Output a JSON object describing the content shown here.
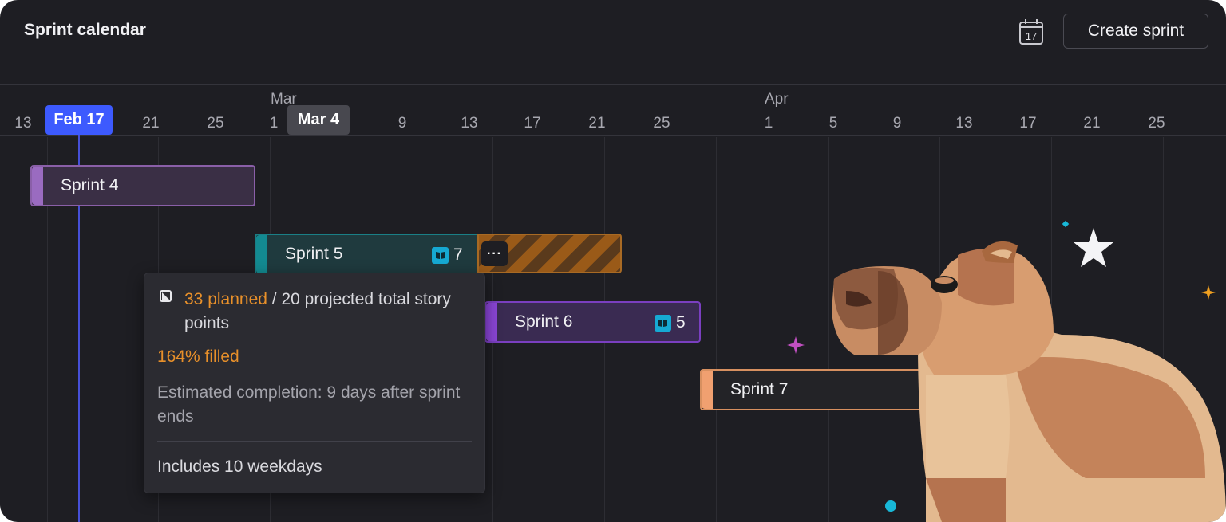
{
  "header": {
    "title": "Sprint calendar",
    "calendar_icon_day": "17",
    "create_button": "Create sprint"
  },
  "timeline": {
    "months": [
      "Mar",
      "Apr"
    ],
    "ticks_left": [
      "13",
      "21",
      "25",
      "1",
      "9",
      "13",
      "17",
      "21",
      "25"
    ],
    "ticks_right": [
      "1",
      "5",
      "9",
      "13",
      "17",
      "21",
      "25"
    ],
    "today_label": "Feb 17",
    "hover_label": "Mar 4"
  },
  "sprints": [
    {
      "name": "Sprint 4",
      "color": "#9a6bc0"
    },
    {
      "name": "Sprint 5",
      "color": "#138a91",
      "count": "7"
    },
    {
      "name": "Sprint 6",
      "color": "#8a45d6",
      "count": "5"
    },
    {
      "name": "Sprint 7",
      "color": "#f0a070"
    }
  ],
  "more_button": "···",
  "tooltip": {
    "planned": "33 planned",
    "rest": " / 20 projected total story points",
    "filled": "164% filled",
    "estimate": "Estimated completion: 9 days after sprint ends",
    "weekdays": "Includes 10 weekdays"
  },
  "colors": {
    "background": "#1e1e23",
    "today": "#3d5afe",
    "overflow": "#9a5a18",
    "accent_orange": "#e8902a"
  },
  "icons": [
    "calendar-icon",
    "book-icon",
    "more-icon",
    "story-points-icon",
    "capybara-illustration",
    "star-icon",
    "sparkle-icon"
  ]
}
